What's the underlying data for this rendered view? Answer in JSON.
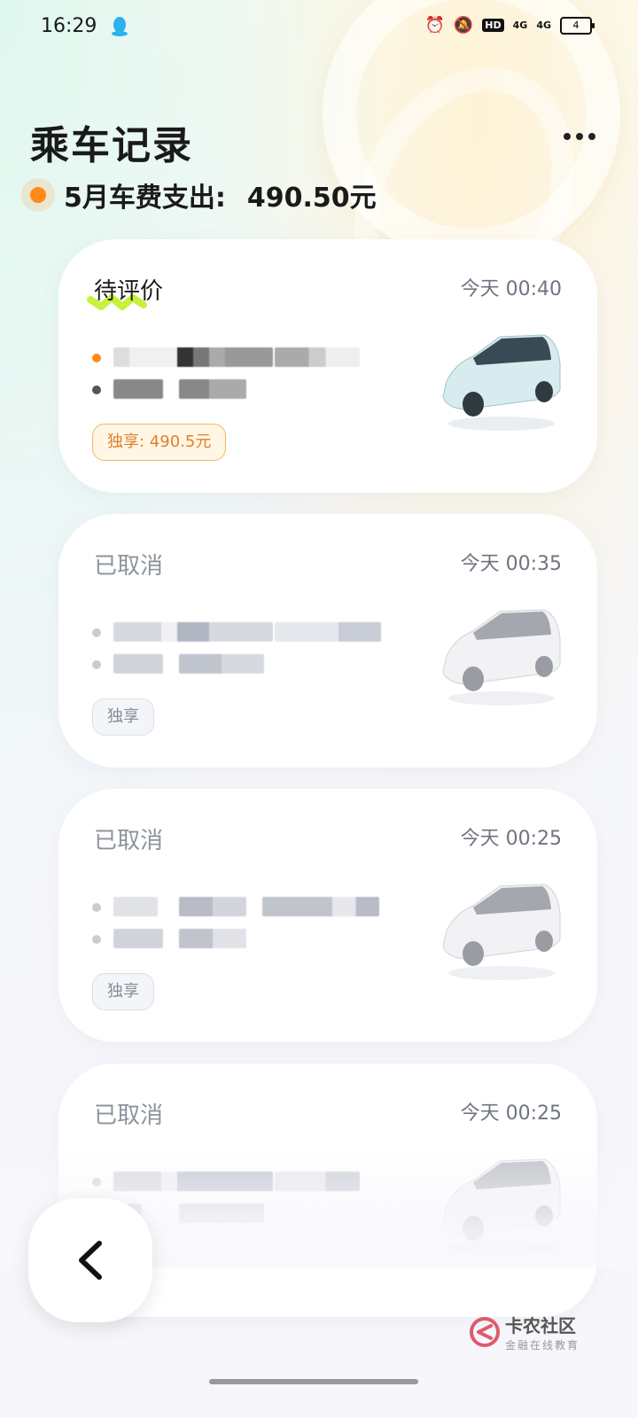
{
  "status_bar": {
    "time": "16:29",
    "hd_label": "HD",
    "signal_1": "4G",
    "signal_2": "4G",
    "battery": "4"
  },
  "header": {
    "title": "乘车记录",
    "summary_label": "5月车费支出:",
    "summary_amount": "490.50元"
  },
  "colors": {
    "accent_orange": "#ff8a1a",
    "active_tag_text": "#e0802a",
    "cancelled_text": "#8d939e"
  },
  "trips": [
    {
      "status": "待评价",
      "time": "今天 00:40",
      "tag": "独享: 490.5元",
      "state": "active"
    },
    {
      "status": "已取消",
      "time": "今天 00:35",
      "tag": "独享",
      "state": "cancelled"
    },
    {
      "status": "已取消",
      "time": "今天 00:25",
      "tag": "独享",
      "state": "cancelled"
    },
    {
      "status": "已取消",
      "time": "今天 00:25",
      "tag": "",
      "state": "cancelled"
    }
  ],
  "icons": {
    "more": "more-dots-icon",
    "back": "chevron-left-icon",
    "car": "car-icon"
  },
  "watermark": {
    "title": "卡农社区",
    "subtitle": "金融在线教育"
  }
}
